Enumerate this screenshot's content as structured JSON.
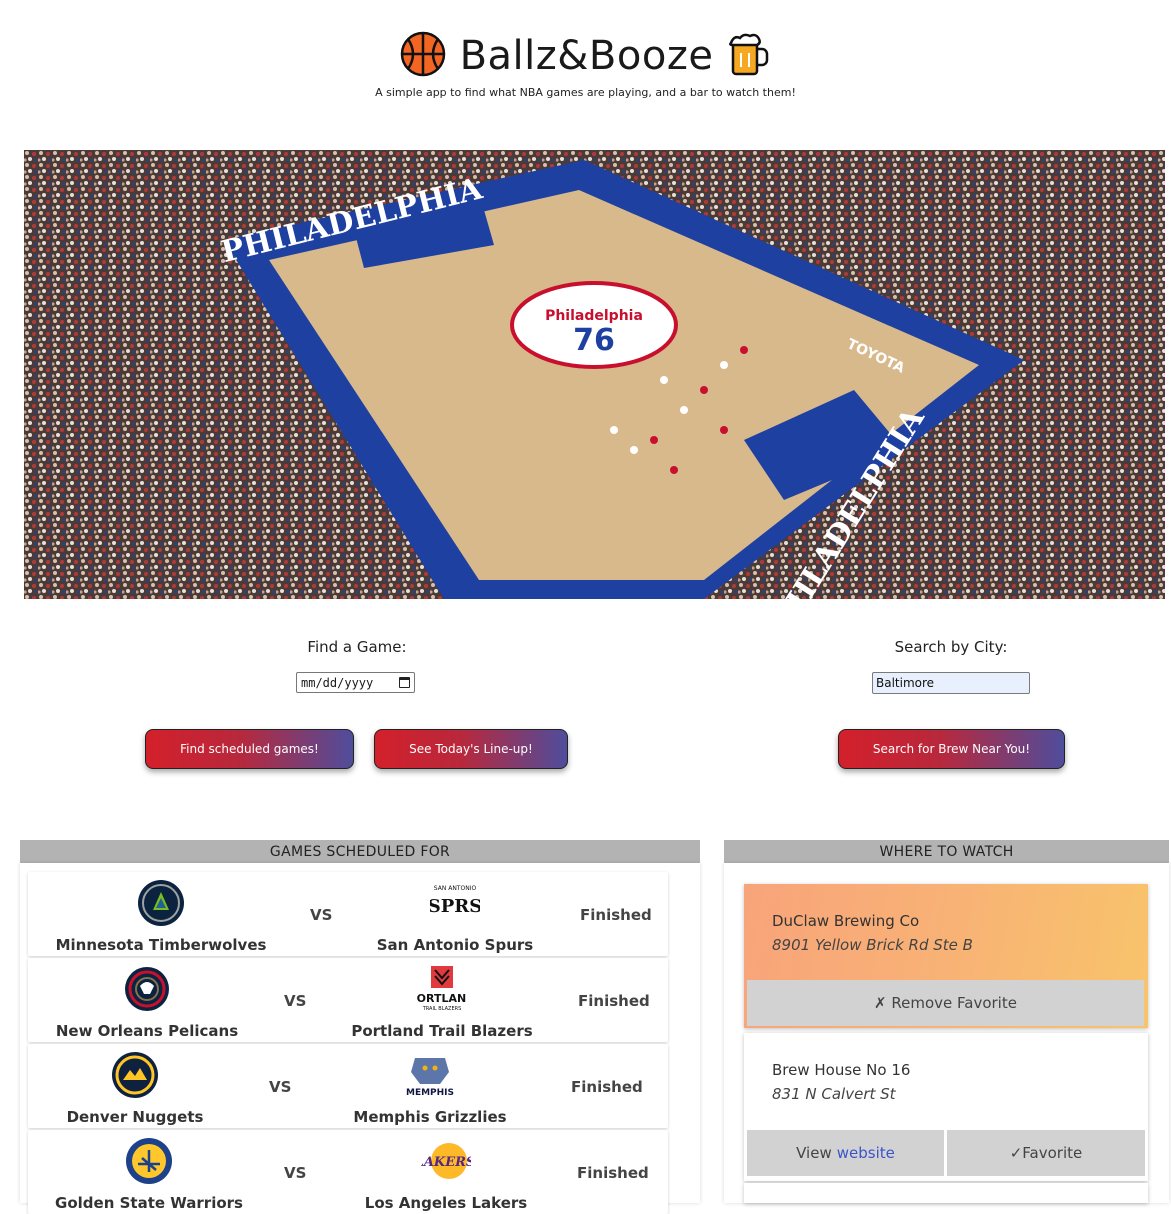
{
  "header": {
    "title": "Ballz&Booze",
    "title_left_icon": "basketball-icon",
    "title_right_icon": "beer-mug-icon",
    "subtitle": "A simple app to find what NBA games are playing, and a bar to watch them!"
  },
  "hero": {
    "court_lettering_top": "PHILADELPHIA",
    "court_lettering_side": "PHILADELPHIA",
    "center_logo": "76",
    "center_logo_text": "Philadelphia",
    "sponsor": "TOYOTA"
  },
  "game_search": {
    "label": "Find a Game:",
    "date_placeholder": "mm/dd/yyyy",
    "find_button": "Find scheduled games!",
    "today_button": "See Today's Line-up!"
  },
  "city_search": {
    "label": "Search by City:",
    "value": "Baltimore",
    "search_button": "Search for Brew Near You!"
  },
  "games": {
    "heading": "GAMES SCHEDULED FOR",
    "vs_label": "VS",
    "rows": [
      {
        "home": "Minnesota Timberwolves",
        "away": "San Antonio Spurs",
        "status": "Finished",
        "home_color": "#0c2340",
        "away_color": "#111111"
      },
      {
        "home": "New Orleans Pelicans",
        "away": "Portland Trail Blazers",
        "status": "Finished",
        "home_color": "#0c2340",
        "away_color": "#e03a3e"
      },
      {
        "home": "Denver Nuggets",
        "away": "Memphis Grizzlies",
        "status": "Finished",
        "home_color": "#0e2240",
        "away_color": "#5d76a9"
      },
      {
        "home": "Golden State Warriors",
        "away": "Los Angeles Lakers",
        "status": "Finished",
        "home_color": "#1d428a",
        "away_color": "#552583"
      }
    ]
  },
  "bars": {
    "heading": "WHERE TO WATCH",
    "items": [
      {
        "name": "DuClaw Brewing Co",
        "address": "8901 Yellow Brick Rd Ste B",
        "remove_label": "✗ Remove Favorite",
        "favorited": true
      },
      {
        "name": "Brew House No 16",
        "address": "831 N Calvert St",
        "view_prefix": "View",
        "view_link": "website",
        "favorite_label": "✓Favorite",
        "favorited": false
      }
    ]
  }
}
